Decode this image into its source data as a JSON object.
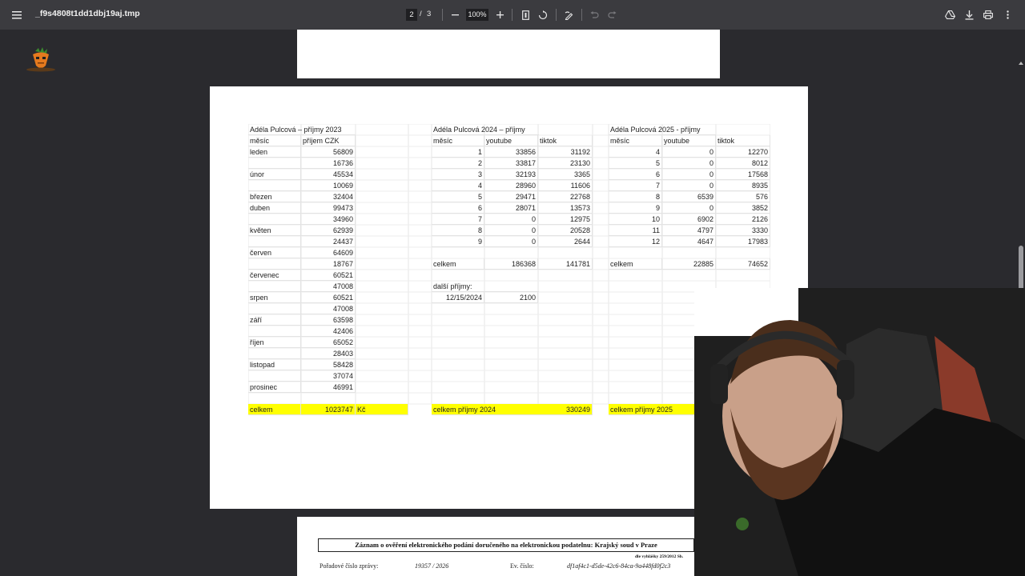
{
  "toolbar": {
    "menu_icon": "menu-icon",
    "file_name": "_f9s4808t1dd1dbj19aj.tmp",
    "current_page": "2",
    "page_separator": "/",
    "total_pages": "3",
    "zoom": "100%",
    "icons": [
      "zoom-out-icon",
      "zoom-in-icon",
      "fit-page-icon",
      "rotate-icon",
      "annotate-icon",
      "undo-icon",
      "redo-icon",
      "drive-icon",
      "download-icon",
      "print-icon",
      "more-icon"
    ]
  },
  "sheet": {
    "t2023": {
      "title": "Adéla Pulcová – příjmy 2023",
      "h_month": "měsíc",
      "h_income": "příjem CZK",
      "rows": [
        {
          "m": "leden",
          "v": "56809"
        },
        {
          "m": "",
          "v": "16736"
        },
        {
          "m": "únor",
          "v": "45534"
        },
        {
          "m": "",
          "v": "10069"
        },
        {
          "m": "březen",
          "v": "32404"
        },
        {
          "m": "duben",
          "v": "99473"
        },
        {
          "m": "",
          "v": "34960"
        },
        {
          "m": "květen",
          "v": "62939"
        },
        {
          "m": "",
          "v": "24437"
        },
        {
          "m": "červen",
          "v": "64609"
        },
        {
          "m": "",
          "v": "18767"
        },
        {
          "m": "červenec",
          "v": "60521"
        },
        {
          "m": "",
          "v": "47008"
        },
        {
          "m": "srpen",
          "v": "60521"
        },
        {
          "m": "",
          "v": "47008"
        },
        {
          "m": "září",
          "v": "63598"
        },
        {
          "m": "",
          "v": "42406"
        },
        {
          "m": "říjen",
          "v": "65052"
        },
        {
          "m": "",
          "v": "28403"
        },
        {
          "m": "listopad",
          "v": "58428"
        },
        {
          "m": "",
          "v": "37074"
        },
        {
          "m": "prosinec",
          "v": "46991"
        }
      ],
      "total_label": "celkem",
      "total_value": "1023747",
      "currency": "Kč"
    },
    "t2024": {
      "title": "Adéla Pulcová 2024 – příjmy",
      "h_month": "měsíc",
      "h_youtube": "youtube",
      "h_tiktok": "tiktok",
      "rows": [
        {
          "m": "1",
          "y": "33856",
          "t": "31192"
        },
        {
          "m": "2",
          "y": "33817",
          "t": "23130"
        },
        {
          "m": "3",
          "y": "32193",
          "t": "3365"
        },
        {
          "m": "4",
          "y": "28960",
          "t": "11606"
        },
        {
          "m": "5",
          "y": "29471",
          "t": "22768"
        },
        {
          "m": "6",
          "y": "28071",
          "t": "13573"
        },
        {
          "m": "7",
          "y": "0",
          "t": "12975"
        },
        {
          "m": "8",
          "y": "0",
          "t": "20528"
        },
        {
          "m": "9",
          "y": "0",
          "t": "2644"
        }
      ],
      "sum_label": "celkem",
      "sum_youtube": "186368",
      "sum_tiktok": "141781",
      "other_label": "další příjmy:",
      "other_date": "12/15/2024",
      "other_value": "2100",
      "total_label": "celkem příjmy 2024",
      "total_value": "330249"
    },
    "t2025": {
      "title": "Adéla Pulcová 2025 - příjmy",
      "h_month": "měsíc",
      "h_youtube": "youtube",
      "h_tiktok": "tiktok",
      "rows": [
        {
          "m": "4",
          "y": "0",
          "t": "12270"
        },
        {
          "m": "5",
          "y": "0",
          "t": "8012"
        },
        {
          "m": "6",
          "y": "0",
          "t": "17568"
        },
        {
          "m": "7",
          "y": "0",
          "t": "8935"
        },
        {
          "m": "8",
          "y": "6539",
          "t": "576"
        },
        {
          "m": "9",
          "y": "0",
          "t": "3852"
        },
        {
          "m": "10",
          "y": "6902",
          "t": "2126"
        },
        {
          "m": "11",
          "y": "4797",
          "t": "3330"
        },
        {
          "m": "12",
          "y": "4647",
          "t": "17983"
        }
      ],
      "sum_label": "celkem",
      "sum_youtube": "22885",
      "sum_tiktok": "74652",
      "total_label": "celkem příjmy 2025"
    }
  },
  "page3": {
    "header": "Záznam o ověření elektronického podání doručeného na elektronickou podatelnu: Krajský soud v Praze",
    "subheader": "dle vyhlášky 259/2012 Sb.",
    "order_label": "Pořadové číslo zprávy:",
    "order_value": "19357 / 2026",
    "ev_label": "Ev. číslo:",
    "ev_value": "df1af4c1-d5de-42c6-84ca-9a448fd0f2c3"
  },
  "colors": {
    "toolbar_bg": "#3b3b3f",
    "viewer_bg": "#2a2a2e",
    "highlight": "#ffff00"
  }
}
